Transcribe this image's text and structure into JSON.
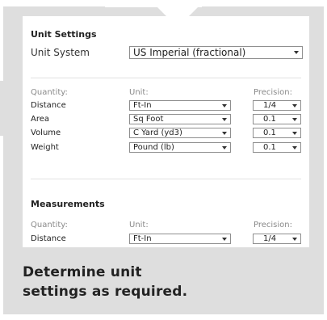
{
  "unit_settings": {
    "title": "Unit Settings",
    "system_label": "Unit System",
    "system_value": "US Imperial (fractional)",
    "headers": {
      "quantity": "Quantity:",
      "unit": "Unit:",
      "precision": "Precision:"
    },
    "rows": [
      {
        "quantity": "Distance",
        "unit": "Ft-In",
        "precision": "1/4"
      },
      {
        "quantity": "Area",
        "unit": "Sq Foot",
        "precision": "0.1"
      },
      {
        "quantity": "Volume",
        "unit": "C Yard (yd3)",
        "precision": "0.1"
      },
      {
        "quantity": "Weight",
        "unit": "Pound (lb)",
        "precision": "0.1"
      }
    ]
  },
  "measurements": {
    "title": "Measurements",
    "headers": {
      "quantity": "Quantity:",
      "unit": "Unit:",
      "precision": "Precision:"
    },
    "rows": [
      {
        "quantity": "Distance",
        "unit": "Ft-In",
        "precision": "1/4"
      }
    ]
  },
  "caption": {
    "line1": "Determine unit",
    "line2": "settings as required."
  },
  "colors": {
    "frame": "#dedede",
    "panel": "#ffffff",
    "text": "#222222"
  },
  "icons": {
    "dropdown": "chevron-down-icon"
  }
}
